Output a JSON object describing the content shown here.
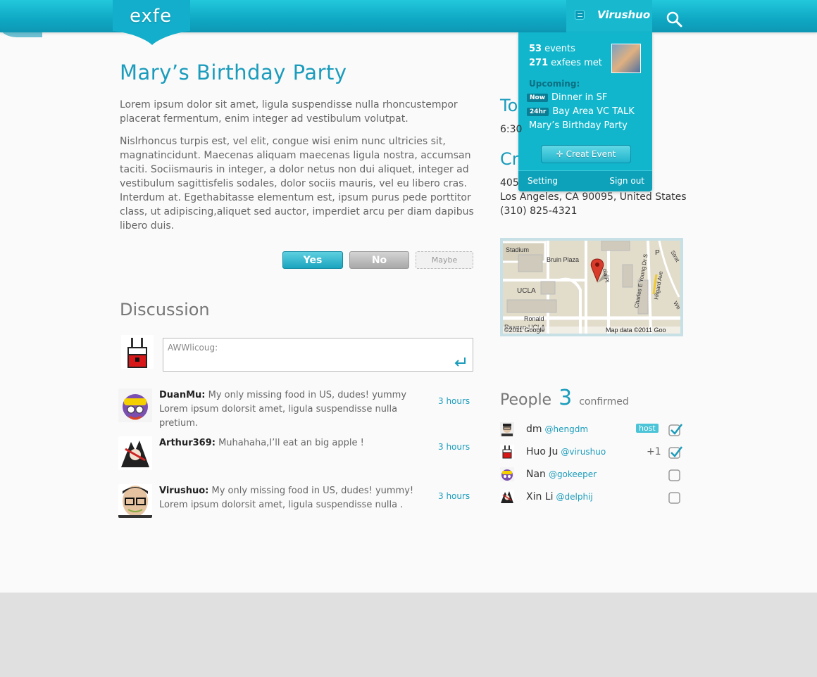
{
  "header": {
    "logo": "exfe",
    "user_name": "Virushuo"
  },
  "user_panel": {
    "events_count": "53",
    "events_label": "events",
    "exfees_count": "271",
    "exfees_label": "exfees met",
    "upcoming_label": "Upcoming:",
    "upcoming": [
      {
        "badge": "Now",
        "title": "Dinner in SF"
      },
      {
        "badge": "24hr",
        "title": "Bay Area VC TALK"
      },
      {
        "badge": "",
        "title": "Mary’s Birthday Party"
      }
    ],
    "create_label": "Creat Event",
    "setting_label": "Setting",
    "signout_label": "Sign out"
  },
  "event": {
    "title": "Mary’s Birthday Party",
    "desc_1": "Lorem ipsum dolor sit amet, ligula suspendisse nulla rhoncustempor placerat fermentum, enim integer ad vestibulum volutpat.",
    "desc_2": "Nislrhoncus turpis est, vel elit, congue wisi enim nunc ultricies sit, magnatincidunt. Maecenas aliquam maecenas ligula nostra, accumsan taciti. Sociismauris in integer, a dolor netus non dui aliquet, integer ad vestibulum sagittisfelis sodales, dolor sociis mauris, vel eu libero cras. Interdum at. Egethabitasse elementum est, ipsum purus pede porttitor class, ut adipiscing,aliquet sed auctor, imperdiet arcu per diam dapibus libero duis.",
    "rsvp_yes": "Yes",
    "rsvp_no": "No",
    "rsvp_maybe": "Maybe"
  },
  "discussion": {
    "heading": "Discussion",
    "input_placeholder": "AWWlicoug:",
    "posts": [
      {
        "author": "DuanMu:",
        "text": "My only missing food in US, dudes! yummy Lorem ipsum dolorsit amet, ligula suspendisse nulla pretium.",
        "time": "3 hours"
      },
      {
        "author": "Arthur369:",
        "text": "Muhahaha,I’ll eat an big apple !",
        "time": "3 hours"
      },
      {
        "author": "Virushuo:",
        "text": "My only missing food in US, dudes! yummy! Lorem ipsum dolorsit amet, ligula suspendisse nulla .",
        "time": "3 hours"
      }
    ]
  },
  "details": {
    "time_heading_visible": "To",
    "time_value_visible": "6:30",
    "place_heading_visible": "Cr",
    "address_line1_visible": "405",
    "address_line2": "Los Angeles, CA 90095, United States",
    "phone": "(310) 825-4321"
  },
  "map": {
    "labels": [
      "Stadium",
      "Bruin Plaza",
      "UCLA",
      "Ronald",
      "Reagan UCLA",
      "Charles E Young Dr S",
      "Hilgard Ave",
      "P",
      "Strat",
      "We",
      "ola Pl"
    ],
    "attribution_left": "©2011 Google",
    "attribution_right": "Map data ©2011 Goo"
  },
  "people": {
    "label": "People",
    "count": "3",
    "confirmed_label": "confirmed",
    "list": [
      {
        "name": "dm",
        "handle": "@hengdm",
        "host": "host",
        "extra": "",
        "confirmed": true
      },
      {
        "name": "Huo Ju",
        "handle": "@virushuo",
        "host": "",
        "extra": "+1",
        "confirmed": true
      },
      {
        "name": "Nan",
        "handle": "@gokeeper",
        "host": "",
        "extra": "",
        "confirmed": false
      },
      {
        "name": "Xin Li",
        "handle": "@delphij",
        "host": "",
        "extra": "",
        "confirmed": false
      }
    ]
  },
  "colors": {
    "accent": "#1a9cbb",
    "header": "#12b6cc"
  }
}
